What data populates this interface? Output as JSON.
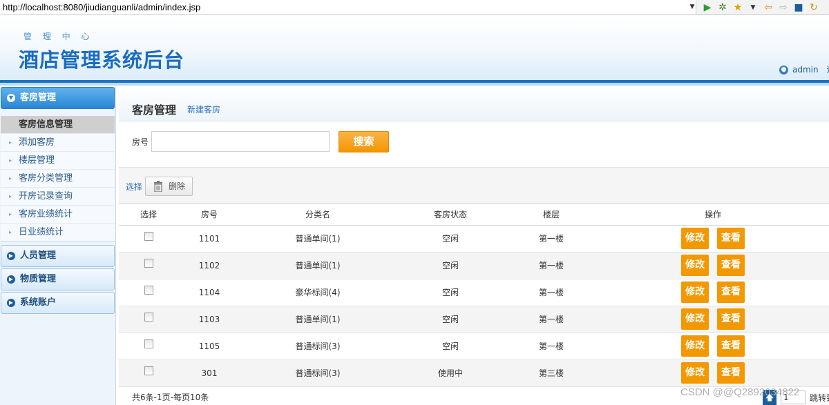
{
  "browser": {
    "url": "http://localhost:8080/jiudianguanli/admin/index.jsp"
  },
  "header": {
    "subtitle": "管 理 中 心",
    "title": "酒店管理系统后台",
    "user": "admin",
    "logout": "退"
  },
  "sidebar": {
    "groups": [
      {
        "label": "客房管理",
        "active": true
      },
      {
        "label": "人员管理"
      },
      {
        "label": "物质管理"
      },
      {
        "label": "系统账户"
      }
    ],
    "items": [
      {
        "label": "客房信息管理",
        "active": true
      },
      {
        "label": "添加客房"
      },
      {
        "label": "楼层管理"
      },
      {
        "label": "客房分类管理"
      },
      {
        "label": "开房记录查询"
      },
      {
        "label": "客房业绩统计"
      },
      {
        "label": "日业绩统计"
      }
    ]
  },
  "main": {
    "title": "客房管理",
    "new_link": "新建客房",
    "search": {
      "label": "房号",
      "value": "",
      "button": "搜索"
    },
    "toolbar": {
      "select": "选择",
      "delete": "删除"
    },
    "table": {
      "headers": [
        "选择",
        "房号",
        "分类名",
        "客房状态",
        "楼层",
        "操作"
      ],
      "rows": [
        [
          "1101",
          "普通单间(1)",
          "空闲",
          "第一楼"
        ],
        [
          "1102",
          "普通单间(1)",
          "空闲",
          "第一楼"
        ],
        [
          "1104",
          "豪华标间(4)",
          "空闲",
          "第一楼"
        ],
        [
          "1103",
          "普通单间(1)",
          "空闲",
          "第一楼"
        ],
        [
          "1105",
          "普通标间(3)",
          "空闲",
          "第一楼"
        ],
        [
          "301",
          "普通标间(3)",
          "使用中",
          "第三楼"
        ]
      ],
      "edit": "修改",
      "view": "查看"
    },
    "footer": "共6条-1页-每页10条",
    "pager": {
      "page": "1",
      "jump": "跳转到"
    }
  },
  "watermark": "CSDN @@Q2892034822"
}
